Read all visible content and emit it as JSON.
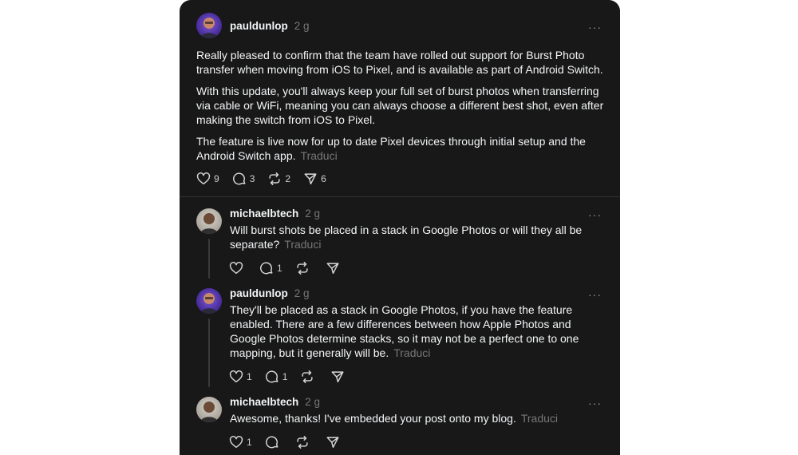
{
  "main_post": {
    "username": "pauldunlop",
    "time": "2 g",
    "paragraphs": [
      "Really pleased to confirm that the team have rolled out support for Burst Photo transfer when moving from iOS to Pixel, and is available as part of Android Switch.",
      "With this update, you'll always keep your full set of burst photos when transferring via cable or WiFi, meaning you can always choose a different best shot, even after making the switch from iOS to Pixel.",
      "The feature is live now for up to date Pixel devices through initial setup and the Android Switch app."
    ],
    "translate": "Traduci",
    "likes": "9",
    "comments": "3",
    "reposts": "2",
    "shares": "6"
  },
  "replies": [
    {
      "username": "michaelbtech",
      "time": "2 g",
      "text": "Will burst shots be placed in a stack in Google Photos or will they all be separate?",
      "translate": "Traduci",
      "likes": "",
      "comments": "1",
      "reposts": "",
      "shares": ""
    },
    {
      "username": "pauldunlop",
      "time": "2 g",
      "text": "They'll be placed as a stack in Google Photos, if you have the feature enabled. There are a few differences between how Apple Photos and Google Photos determine stacks, so it may not be a perfect one to one mapping, but it generally will be.",
      "translate": "Traduci",
      "likes": "1",
      "comments": "1",
      "reposts": "",
      "shares": ""
    },
    {
      "username": "michaelbtech",
      "time": "2 g",
      "text": "Awesome, thanks! I've embedded your post onto my blog.",
      "translate": "Traduci",
      "likes": "1",
      "comments": "",
      "reposts": "",
      "shares": ""
    }
  ],
  "more_glyph": "···",
  "colors": {
    "background": "#181818",
    "text": "#f3f5f7",
    "muted": "#777777",
    "divider": "#323232"
  }
}
